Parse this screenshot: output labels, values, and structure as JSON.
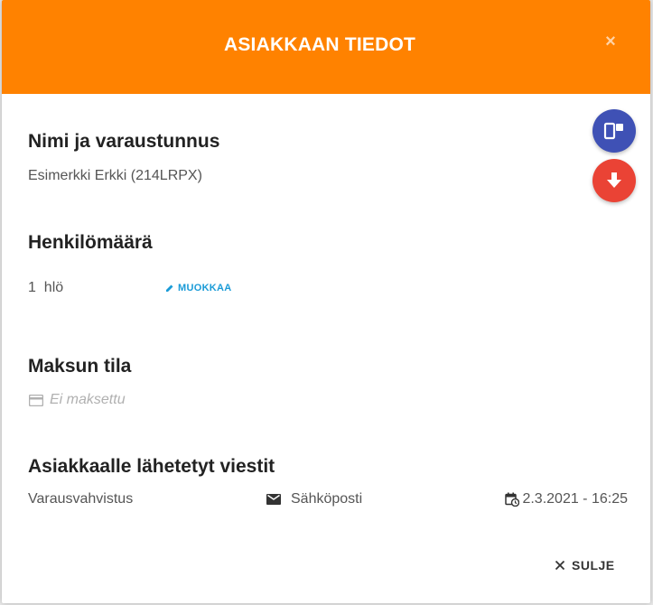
{
  "dialog": {
    "title": "ASIAKKAAN TIEDOT",
    "close_symbol": "×",
    "close_label": "SULJE"
  },
  "actions": {
    "primary_icon": "device-switch-icon",
    "secondary_icon": "download-arrow-icon",
    "colors": {
      "primary": "#3f51b5",
      "secondary": "#ea4335",
      "header": "#ff8200"
    }
  },
  "name_section": {
    "title": "Nimi ja varaustunnus",
    "value": "Esimerkki Erkki (214LRPX)"
  },
  "people_section": {
    "title": "Henkilömäärä",
    "value": "1  hlö",
    "edit_label": "MUOKKAA"
  },
  "payment_section": {
    "title": "Maksun tila",
    "status": "Ei maksettu",
    "icon": "credit-card-icon"
  },
  "messages_section": {
    "title": "Asiakkaalle lähetetyt viestit",
    "rows": [
      {
        "type": "Varausvahvistus",
        "channel": "Sähköposti",
        "channel_icon": "mail-icon",
        "time": "2.3.2021 - 16:25",
        "time_icon": "calendar-clock-icon"
      }
    ]
  }
}
